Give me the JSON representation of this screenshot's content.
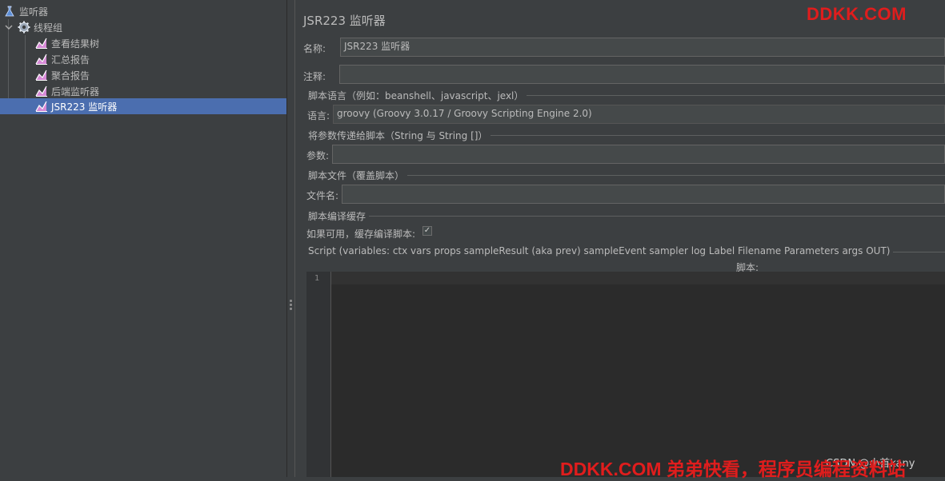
{
  "tree": {
    "root": {
      "label": "监听器",
      "icon": "flask-icon"
    },
    "thread_group": {
      "label": "线程组",
      "icon": "gear-icon"
    },
    "children": [
      {
        "label": "查看结果树",
        "icon": "chart-icon"
      },
      {
        "label": "汇总报告",
        "icon": "chart-icon"
      },
      {
        "label": "聚合报告",
        "icon": "chart-icon"
      },
      {
        "label": "后端监听器",
        "icon": "chart-icon"
      },
      {
        "label": "JSR223 监听器",
        "icon": "chart-icon",
        "selected": true
      }
    ]
  },
  "panel": {
    "title": "JSR223 监听器",
    "name_label": "名称:",
    "name_value": "JSR223 监听器",
    "comment_label": "注释:",
    "comment_value": "",
    "lang_section": "脚本语言（例如：beanshell、javascript、jexl）",
    "lang_label": "语言:",
    "lang_value": "groovy     (Groovy 3.0.17 / Groovy Scripting Engine 2.0)",
    "params_section": "将参数传递给脚本（String 与 String []）",
    "params_label": "参数:",
    "params_value": "",
    "file_section": "脚本文件（覆盖脚本）",
    "file_label": "文件名:",
    "file_value": "",
    "cache_section": "脚本编译缓存",
    "cache_label": "如果可用，缓存编译脚本:",
    "cache_checked": true,
    "script_section": "Script (variables: ctx vars props sampleResult (aka prev) sampleEvent sampler log Label Filename Parameters args OUT)",
    "script_label": "脚本:",
    "line_number": "1"
  },
  "watermarks": {
    "top": "DDKK.COM",
    "bottom": "DDKK.COM 弟弟快看，程序员编程资料站",
    "csdn": "CSDN @小首kany"
  },
  "colors": {
    "background": "#3c3f41",
    "selection": "#4b6eaf",
    "watermark": "#e01d1d"
  }
}
